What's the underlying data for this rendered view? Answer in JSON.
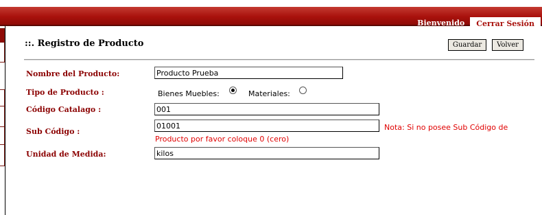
{
  "header": {
    "welcome_label": "Bienvenido",
    "logout_label": "Cerrar Sesión"
  },
  "form": {
    "title": "::. Registro de Producto",
    "save_label": "Guardar",
    "back_label": "Volver",
    "product_name": {
      "label": "Nombre del Producto",
      "label_suffix": ":",
      "value": "Producto Prueba"
    },
    "product_type": {
      "label": "Tipo de Producto",
      "label_suffix": ":",
      "option1_label": "Bienes Muebles:",
      "option2_label": "Materiales:",
      "selected": "Bienes Muebles"
    },
    "catalog_code": {
      "label": "Código Catalago",
      "label_suffix": ":",
      "value": "001"
    },
    "sub_code": {
      "label": "Sub Código",
      "label_suffix": ":",
      "value": "01001",
      "note_line1": "Nota: Si no posee Sub Código de",
      "note_line2": "Producto por favor coloque 0 (cero)"
    },
    "unit": {
      "label": "Unidad de Medida",
      "label_suffix": ":",
      "value": "kilos"
    }
  },
  "colors": {
    "brand": "#a8110c",
    "label": "#8b0000",
    "note": "#e00000"
  }
}
